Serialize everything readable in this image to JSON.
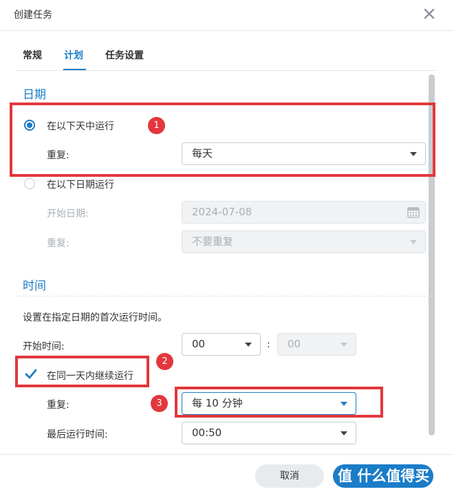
{
  "dialog": {
    "title": "创建任务"
  },
  "tabs": [
    {
      "label": "常规"
    },
    {
      "label": "计划"
    },
    {
      "label": "任务设置"
    }
  ],
  "date_section": {
    "heading": "日期",
    "radio_daily": "在以下天中运行",
    "repeat_label": "重复:",
    "repeat_value": "每天",
    "radio_date": "在以下日期运行",
    "start_date_label": "开始日期:",
    "start_date_value": "2024-07-08",
    "repeat2_label": "重复:",
    "repeat2_value": "不要重复"
  },
  "time_section": {
    "heading": "时间",
    "description": "设置在指定日期的首次运行时间。",
    "start_time_label": "开始时间:",
    "hour_value": "00",
    "colon": ":",
    "minute_value": "00",
    "continue_label": "在同一天内继续运行",
    "repeat_label": "重复:",
    "repeat_value": "每 10 分钟",
    "last_run_label": "最后运行时间:",
    "last_run_value": "00:50"
  },
  "badges": [
    "1",
    "2",
    "3"
  ],
  "footer": {
    "cancel": "取消",
    "watermark": "值 什么值得买"
  },
  "colors": {
    "accent": "#1b7cc8",
    "annotation": "#e2373c"
  }
}
